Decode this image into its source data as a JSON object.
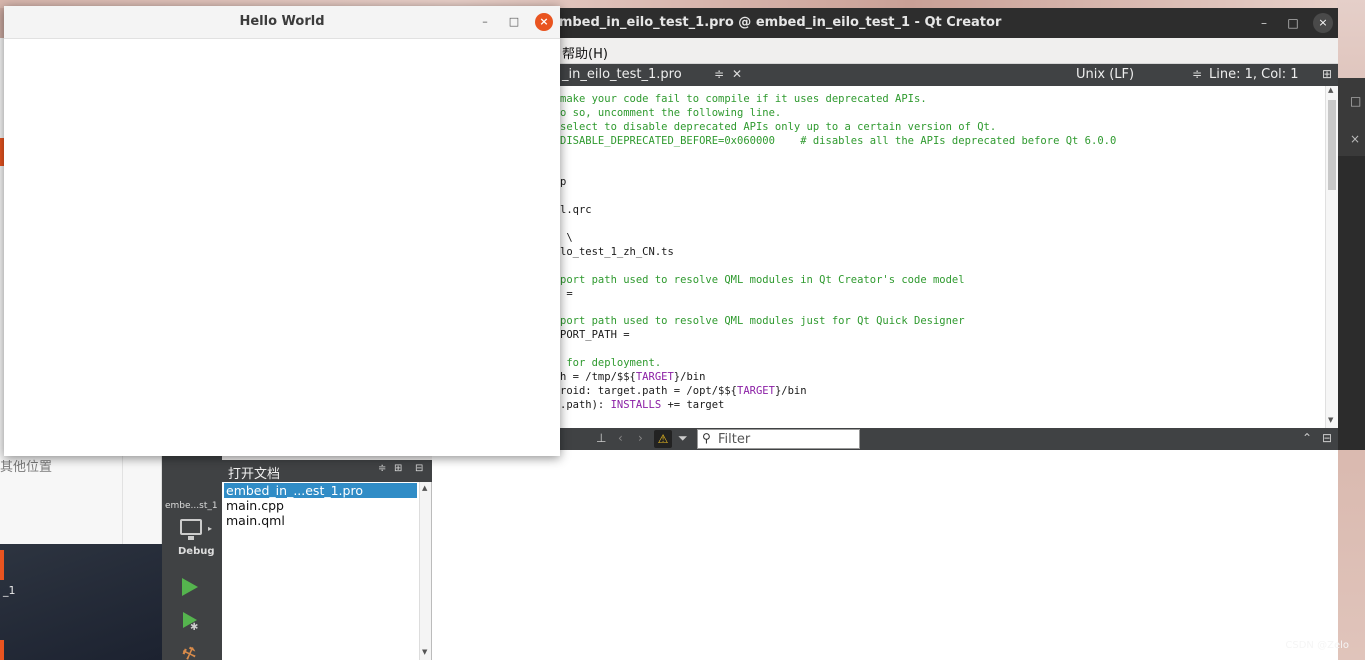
{
  "hello_window": {
    "title": "Hello World",
    "min": "–",
    "max": "□",
    "close": "×"
  },
  "qtcreator": {
    "window_title": "embed_in_eilo_test_1.pro @ embed_in_eilo_test_1 - Qt Creator",
    "win_min": "–",
    "win_max": "□",
    "win_close": "×",
    "menu_help": "帮助(H)",
    "editor_toolbar": {
      "file": "_in_eilo_test_1.pro",
      "file_arrows": "≑",
      "close": "✕",
      "line_ending": "Unix (LF)",
      "le_arrows": "≑",
      "position": "Line: 1, Col: 1",
      "split": "⊞"
    },
    "code_lines": [
      {
        "text": "make your code fail to compile if it uses deprecated APIs.",
        "comment": true
      },
      {
        "text": "o so, uncomment the following line.",
        "comment": true
      },
      {
        "text": "select to disable deprecated APIs only up to a certain version of Qt.",
        "comment": true
      },
      {
        "text": "DISABLE_DEPRECATED_BEFORE=0x060000    # disables all the APIs deprecated before Qt 6.0.0",
        "comment": true
      },
      {
        "text": "",
        "comment": false
      },
      {
        "text": "",
        "comment": false
      },
      {
        "text": "p",
        "comment": false
      },
      {
        "text": "",
        "comment": false
      },
      {
        "text": "l.qrc",
        "comment": false
      },
      {
        "text": "",
        "comment": false
      },
      {
        "text": " \\",
        "comment": false
      },
      {
        "text": "lo_test_1_zh_CN.ts",
        "comment": false
      },
      {
        "text": "",
        "comment": false
      },
      {
        "text": "port path used to resolve QML modules in Qt Creator's code model",
        "comment": true
      },
      {
        "text": " =",
        "comment": false
      },
      {
        "text": "",
        "comment": false
      },
      {
        "text": "port path used to resolve QML modules just for Qt Quick Designer",
        "comment": true
      },
      {
        "text": "PORT_PATH =",
        "comment": false
      },
      {
        "text": "",
        "comment": false
      },
      {
        "text": " for deployment.",
        "comment": true
      },
      {
        "text": "h = /tmp/$${TARGET}/bin",
        "comment": false
      },
      {
        "text": "roid: target.path = /opt/$${TARGET}/bin",
        "comment": false
      },
      {
        "text": ".path): INSTALLS += target",
        "comment": false
      }
    ],
    "open_docs": {
      "title": "打开文档",
      "items": [
        "embed_in_...est_1.pro",
        "main.cpp",
        "main.qml"
      ],
      "selected_index": 0
    },
    "kit": {
      "project": "embe...st_1",
      "build_config": "Debug"
    },
    "output": {
      "filter_placeholder": "Filter",
      "warn_icon": "⚠",
      "filter_icon": "⏷",
      "prev": "‹",
      "next": "›",
      "collapse": "⌃",
      "maximize": "⊟"
    }
  },
  "background": {
    "filemgr_other": "其他位置",
    "dock_label": "_1"
  },
  "watermark": "CSDN @Zelo"
}
